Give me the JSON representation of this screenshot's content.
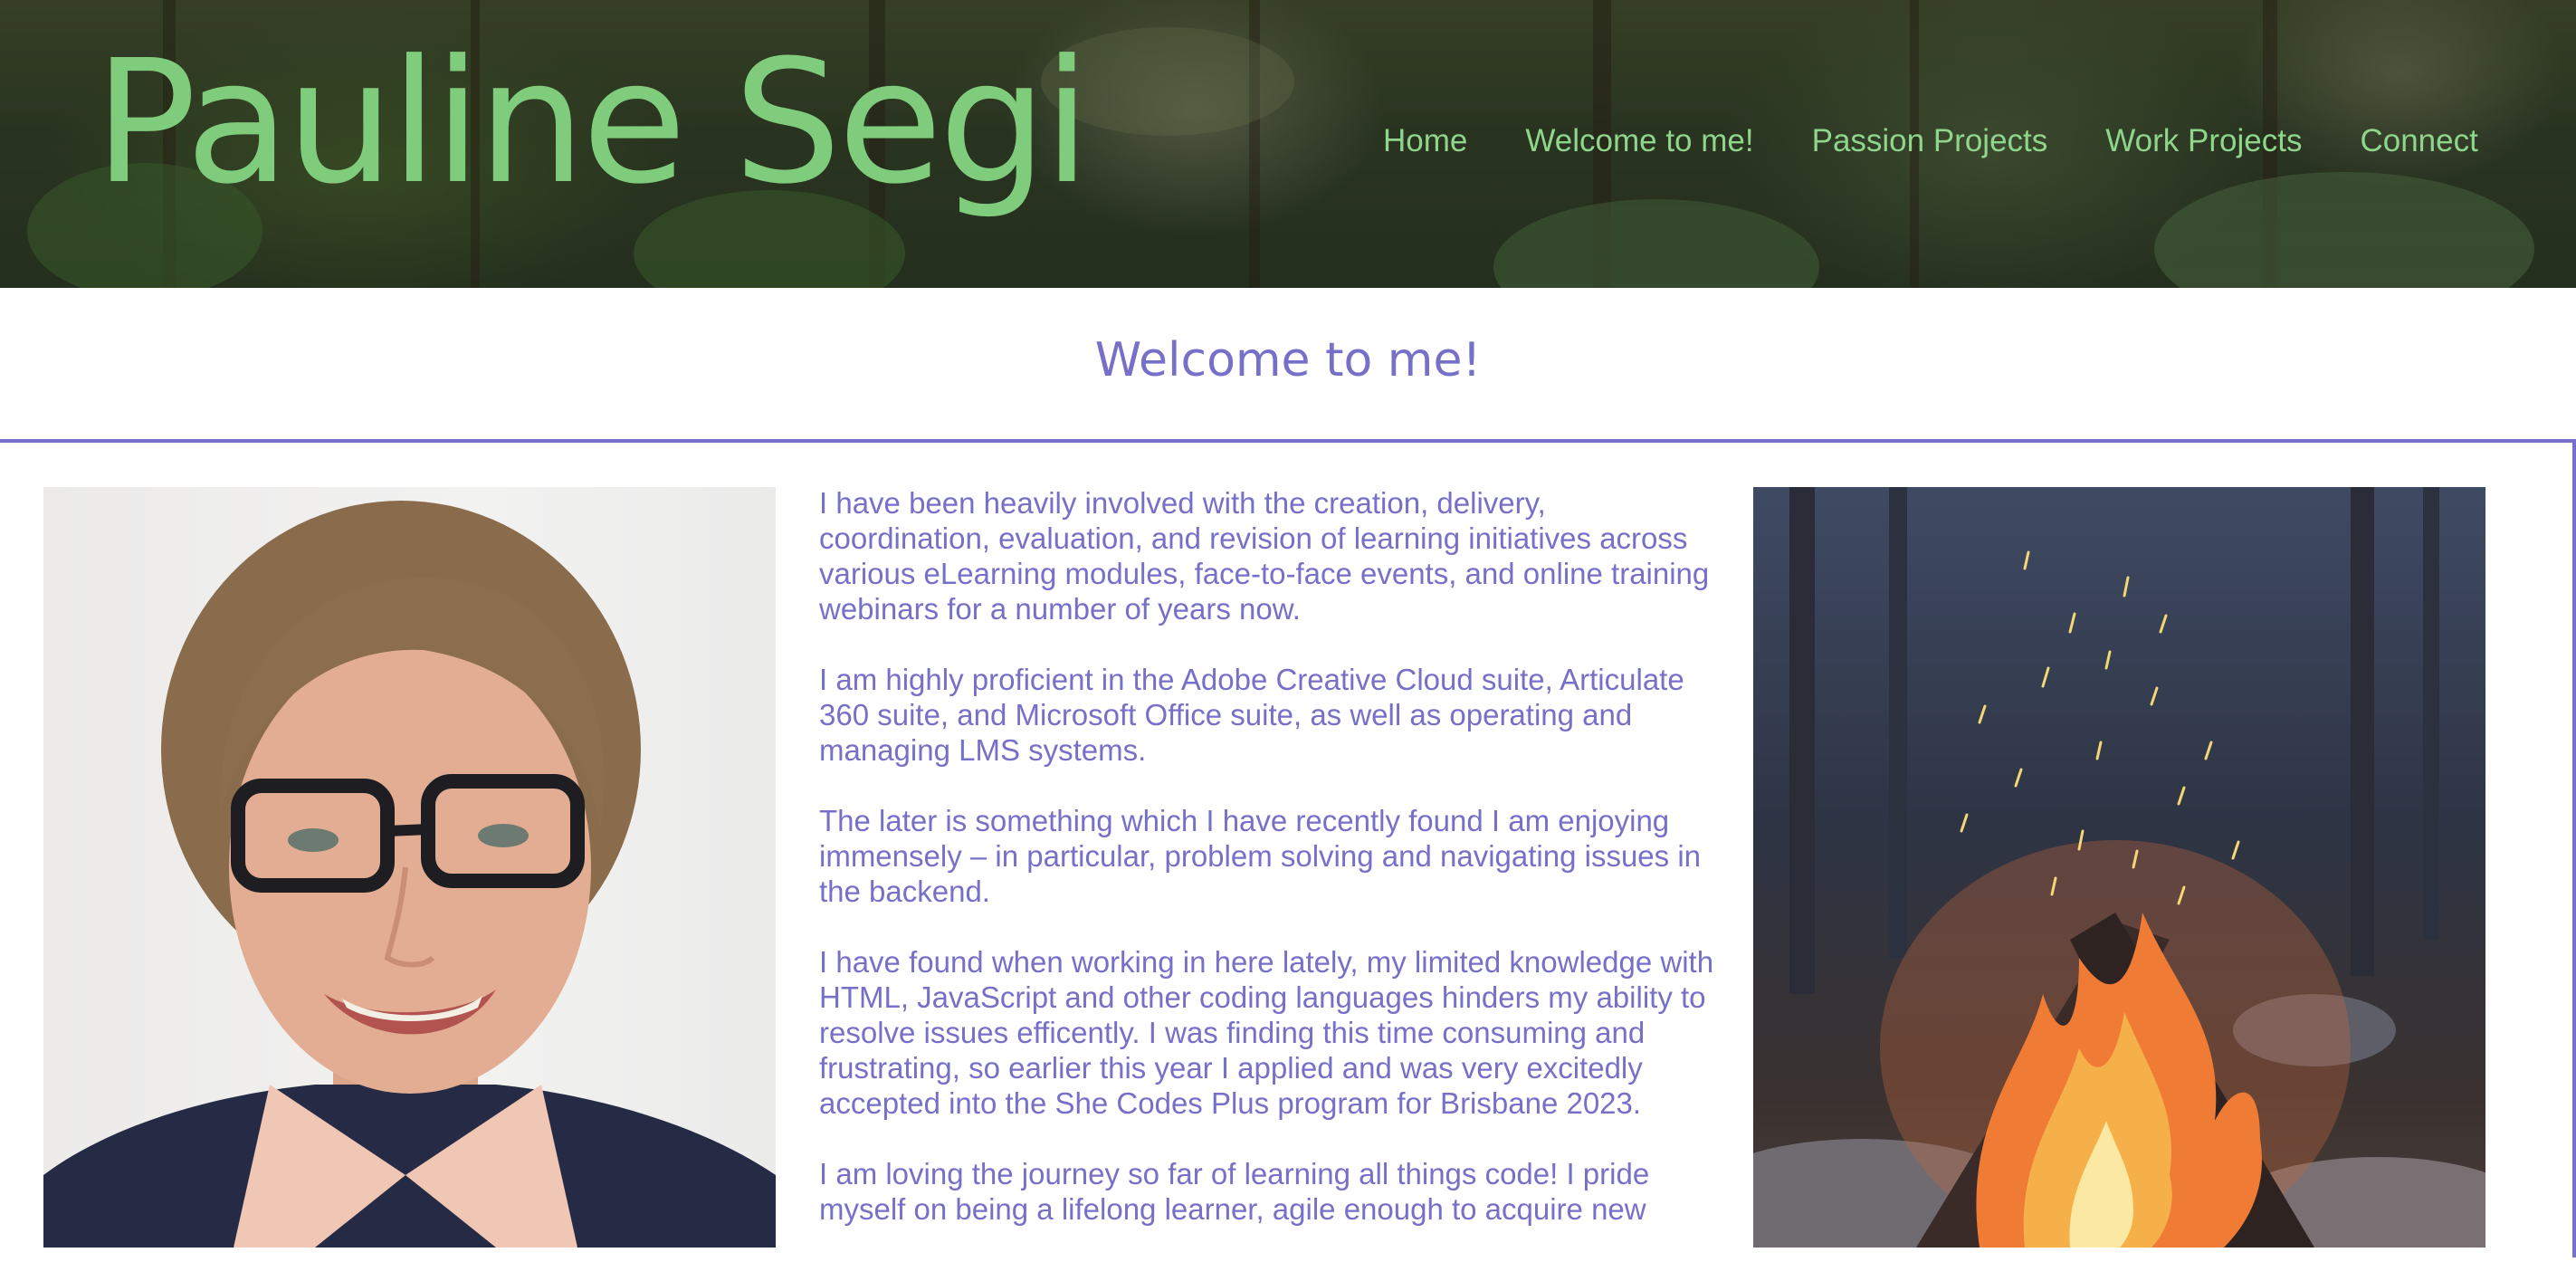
{
  "site": {
    "title": "Pauline Segi"
  },
  "nav": {
    "items": [
      {
        "label": "Home"
      },
      {
        "label": "Welcome to me!"
      },
      {
        "label": "Passion Projects"
      },
      {
        "label": "Work Projects"
      },
      {
        "label": "Connect"
      }
    ]
  },
  "section": {
    "heading": "Welcome to me!"
  },
  "bio": {
    "paragraphs": [
      "I have been heavily involved with the creation, delivery, coordination, evaluation, and revision of learning initiatives across various eLearning modules, face-to-face events, and online training webinars for a number of years now.",
      "I am highly proficient in the Adobe Creative Cloud suite, Articulate 360 suite, and Microsoft Office suite, as well as operating and managing LMS systems.",
      "The later is something which I have recently found I am enjoying immensely – in particular, problem solving and navigating issues in the backend.",
      "I have found when working in here lately, my limited knowledge with HTML, JavaScript and other coding languages hinders my ability to resolve issues efficently. I was finding this time consuming and frustrating, so earlier this year I applied and was very excitedly accepted into the She Codes Plus program for Brisbane 2023.",
      "I am loving the journey so far of learning all things code! I pride myself on being a lifelong learner, agile enough to acquire new"
    ]
  },
  "colors": {
    "title_green": "#7fcc7c",
    "nav_green": "#8fd58b",
    "accent_purple": "#7670c8"
  }
}
